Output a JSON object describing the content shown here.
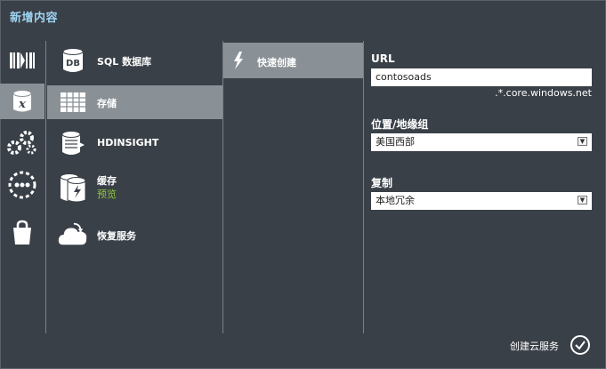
{
  "title": "新增内容",
  "categories": [
    {
      "icon": "web-sites-icon"
    },
    {
      "icon": "data-services-icon"
    },
    {
      "icon": "app-services-icon"
    },
    {
      "icon": "network-services-icon"
    },
    {
      "icon": "store-icon"
    }
  ],
  "services": [
    {
      "label": "SQL 数据库",
      "sub": "",
      "icon": "sql-database-icon"
    },
    {
      "label": "存储",
      "sub": "",
      "icon": "storage-table-icon"
    },
    {
      "label": "HDINSIGHT",
      "sub": "",
      "icon": "hdinsight-icon"
    },
    {
      "label": "缓存",
      "sub": "预览",
      "icon": "cache-icon"
    },
    {
      "label": "恢复服务",
      "sub": "",
      "icon": "recovery-cloud-icon"
    }
  ],
  "action": {
    "label": "快速创建",
    "icon": "lightning-icon"
  },
  "form": {
    "url_label": "URL",
    "url_value": "contosoads",
    "url_suffix": ".*.core.windows.net",
    "location_label": "位置/地缘组",
    "location_value": "美国西部",
    "replication_label": "复制",
    "replication_value": "本地冗余"
  },
  "footer": {
    "create_label": "创建云服务"
  },
  "colors": {
    "background": "#3a4048",
    "selected": "#8a9196",
    "title": "#9fd4f1",
    "preview": "#8fc63d"
  }
}
